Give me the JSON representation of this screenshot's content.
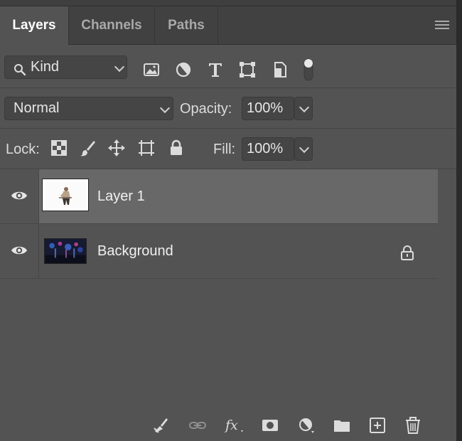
{
  "tabs": [
    {
      "label": "Layers"
    },
    {
      "label": "Channels"
    },
    {
      "label": "Paths"
    }
  ],
  "filter": {
    "kind_label": "Kind",
    "icons": [
      "image-filter-icon",
      "adjustment-filter-icon",
      "type-filter-icon",
      "shape-filter-icon",
      "smart-object-filter-icon",
      "filter-toggle-icon"
    ]
  },
  "blend": {
    "mode": "Normal",
    "opacity_label": "Opacity:",
    "opacity_value": "100%"
  },
  "lock": {
    "label": "Lock:",
    "fill_label": "Fill:",
    "fill_value": "100%",
    "icons": [
      "lock-transparent-pixels-icon",
      "lock-image-pixels-icon",
      "lock-position-icon",
      "artboard-lock-icon",
      "lock-all-icon"
    ]
  },
  "layers": [
    {
      "name": "Layer 1",
      "selected": true,
      "visible": true,
      "locked": false
    },
    {
      "name": "Background",
      "selected": false,
      "visible": true,
      "locked": true
    }
  ],
  "bottom_icons": [
    "brush-cleanup-icon",
    "link-layers-icon",
    "fx-icon",
    "layer-mask-icon",
    "adjustment-layer-icon",
    "group-folder-icon",
    "new-layer-icon",
    "trash-icon"
  ],
  "colors": {
    "panel_bg": "#535353",
    "selected_row": "#686868",
    "tab_active_text": "#ffffff"
  }
}
